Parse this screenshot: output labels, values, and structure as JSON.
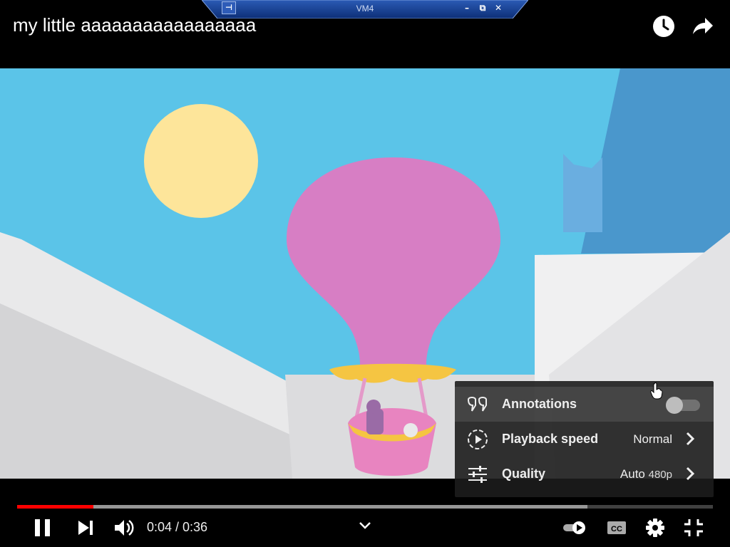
{
  "vm_bar": {
    "title": "VM4",
    "pin_icon": "pin-icon",
    "minimize_icon": "minimize-icon",
    "restore_icon": "restore-icon",
    "close_icon": "close-icon"
  },
  "header": {
    "title": "my little aaaaaaaaaaaaaaaaa",
    "watch_later_icon": "clock-icon",
    "share_icon": "share-arrow-icon"
  },
  "settings_menu": {
    "items": [
      {
        "label": "Annotations",
        "icon": "annotations-icon",
        "toggle_on": false
      },
      {
        "label": "Playback speed",
        "icon": "playback-speed-icon",
        "value": "Normal"
      },
      {
        "label": "Quality",
        "icon": "quality-sliders-icon",
        "value": "Auto",
        "value_sub": "480p"
      }
    ]
  },
  "player": {
    "current_time": "0:04",
    "duration": "0:36",
    "time_display": "0:04 / 0:36",
    "played_fraction": 0.11,
    "buffered_fraction": 0.82,
    "colors": {
      "played": "#ff0000",
      "menu_bg": "#1c1c1c"
    },
    "controls": [
      "pause-icon",
      "next-icon",
      "volume-icon",
      "chevron-down-icon",
      "autoplay-toggle-icon",
      "captions-icon",
      "settings-gear-icon",
      "exit-fullscreen-icon"
    ]
  }
}
